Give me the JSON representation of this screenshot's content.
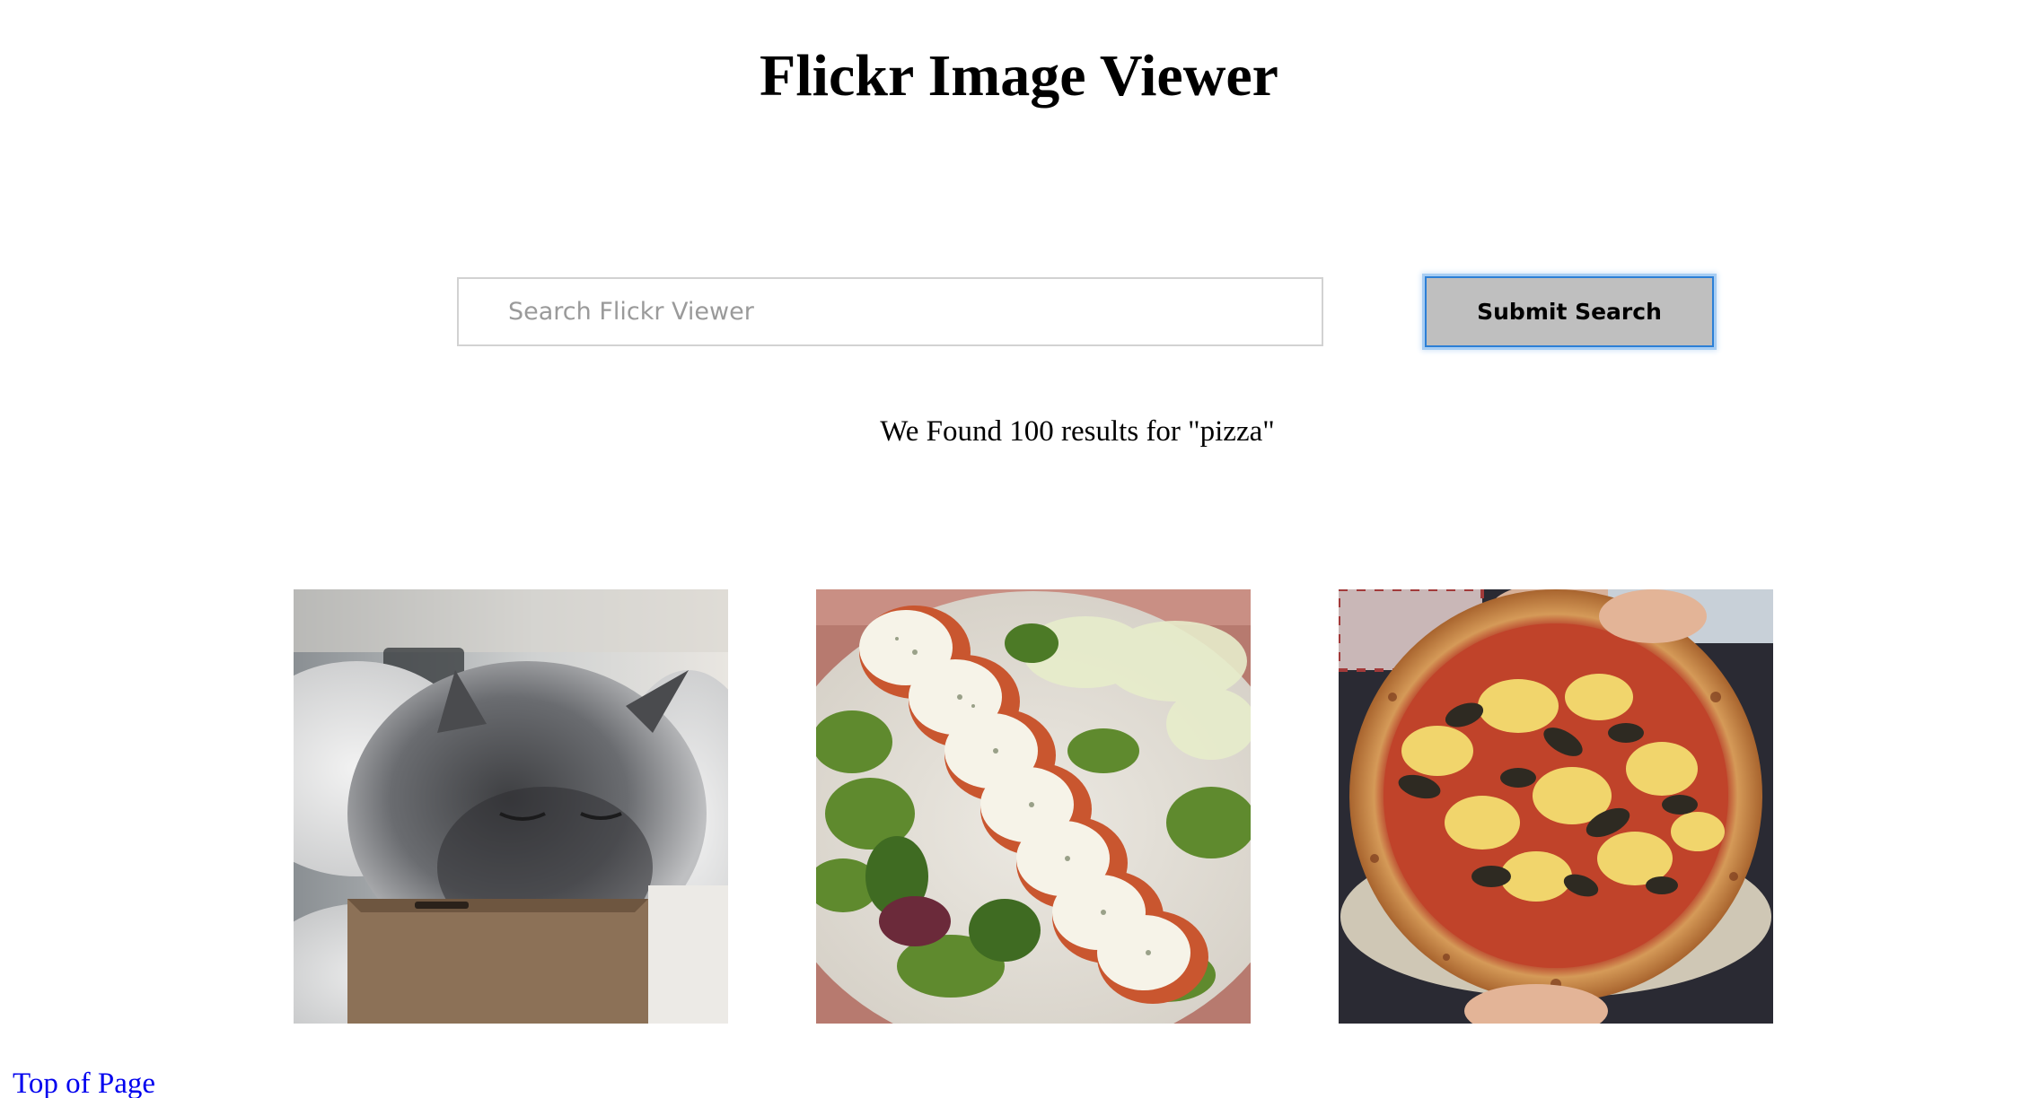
{
  "header": {
    "title": "Flickr Image Viewer"
  },
  "search": {
    "placeholder": "Search Flickr Viewer",
    "value": "",
    "submit_label": "Submit Search"
  },
  "results": {
    "prefix": "We Found",
    "count": "100",
    "middle": "results for",
    "query": "\"pizza\""
  },
  "photos": [
    {
      "subject": "fluffy gray cat sleeping in cardboard pizza box"
    },
    {
      "subject": "caprese salad with tomato, mozzarella, basil and greens"
    },
    {
      "subject": "margherita-style pizza with mozzarella and vegetables"
    }
  ],
  "footer": {
    "top_link": "Top of Page"
  },
  "colors": {
    "link": "#0000ee",
    "button_bg": "#bfbfbf",
    "button_focus_ring": "#2c7fd6",
    "input_border": "#d2d2d2"
  }
}
